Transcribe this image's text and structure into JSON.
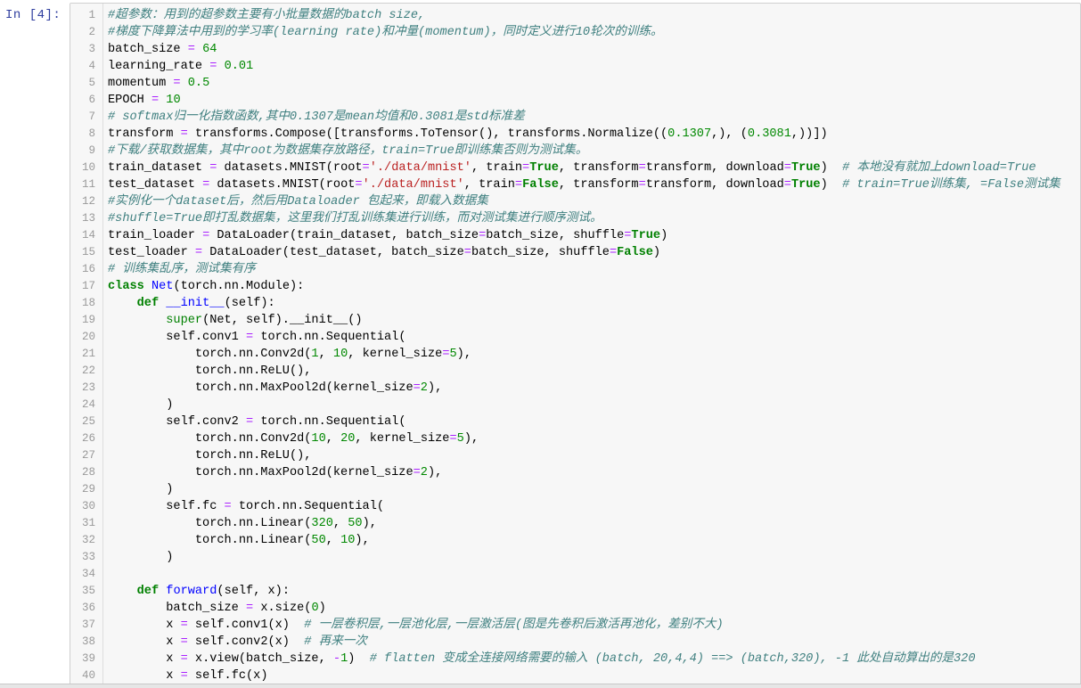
{
  "cell": {
    "prompt": "In  [4]:",
    "lines": [
      "#超参数：用到的超参数主要有小批量数据的batch size,",
      "#梯度下降算法中用到的学习率(learning rate)和冲量(momentum)，同时定义进行10轮次的训练。",
      "batch_size = 64",
      "learning_rate = 0.01",
      "momentum = 0.5",
      "EPOCH = 10",
      "# softmax归一化指数函数,其中0.1307是mean均值和0.3081是std标准差",
      "transform = transforms.Compose([transforms.ToTensor(), transforms.Normalize((0.1307,), (0.3081,))])",
      "#下载/获取数据集，其中root为数据集存放路径，train=True即训练集否则为测试集。",
      "train_dataset = datasets.MNIST(root='./data/mnist', train=True, transform=transform, download=True)  # 本地没有就加上download=True",
      "test_dataset = datasets.MNIST(root='./data/mnist', train=False, transform=transform, download=True)  # train=True训练集, =False测试集",
      "#实例化一个dataset后，然后用Dataloader 包起来，即载入数据集",
      "#shuffle=True即打乱数据集，这里我们打乱训练集进行训练，而对测试集进行顺序测试。",
      "train_loader = DataLoader(train_dataset, batch_size=batch_size, shuffle=True)",
      "test_loader = DataLoader(test_dataset, batch_size=batch_size, shuffle=False)",
      "# 训练集乱序，测试集有序",
      "class Net(torch.nn.Module):",
      "    def __init__(self):",
      "        super(Net, self).__init__()",
      "        self.conv1 = torch.nn.Sequential(",
      "            torch.nn.Conv2d(1, 10, kernel_size=5),",
      "            torch.nn.ReLU(),",
      "            torch.nn.MaxPool2d(kernel_size=2),",
      "        )",
      "        self.conv2 = torch.nn.Sequential(",
      "            torch.nn.Conv2d(10, 20, kernel_size=5),",
      "            torch.nn.ReLU(),",
      "            torch.nn.MaxPool2d(kernel_size=2),",
      "        )",
      "        self.fc = torch.nn.Sequential(",
      "            torch.nn.Linear(320, 50),",
      "            torch.nn.Linear(50, 10),",
      "        )",
      "",
      "    def forward(self, x):",
      "        batch_size = x.size(0)",
      "        x = self.conv1(x)  # 一层卷积层,一层池化层,一层激活层(图是先卷积后激活再池化，差别不大)",
      "        x = self.conv2(x)  # 再来一次",
      "        x = x.view(batch_size, -1)  # flatten 变成全连接网络需要的输入 (batch, 20,4,4) ==> (batch,320), -1 此处自动算出的是320",
      "        x = self.fc(x)"
    ]
  },
  "colors": {
    "comment": "#408080",
    "keyword": "#008000",
    "number": "#008800",
    "string": "#ba2121",
    "operator": "#aa22ff",
    "prompt": "#303f9f",
    "cell_border": "#cfcfcf",
    "cell_bg": "#f7f7f7"
  }
}
